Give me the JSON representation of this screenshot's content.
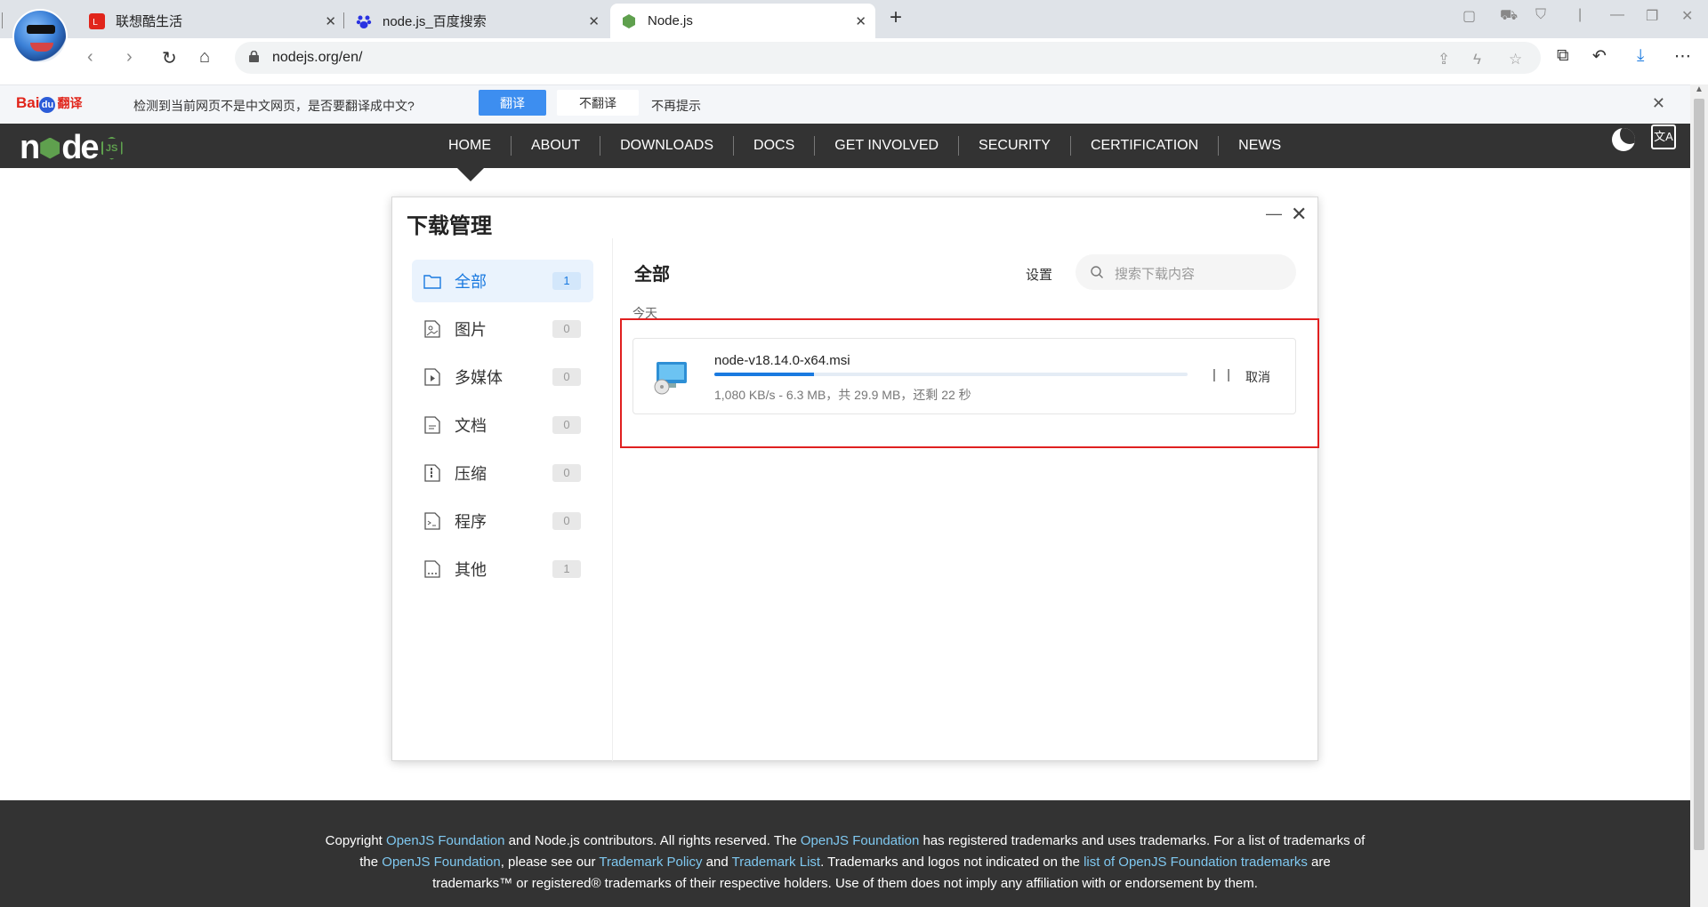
{
  "browser": {
    "tabs": [
      {
        "title": "联想酷生活",
        "icon": "lenovo-icon"
      },
      {
        "title": "node.js_百度搜索",
        "icon": "baidu-paw-icon"
      },
      {
        "title": "Node.js",
        "icon": "nodejs-hex-icon",
        "active": true
      }
    ],
    "new_tab_label": "+",
    "url": "nodejs.org/en/",
    "accent_color": "#1a7ae0"
  },
  "translate_bar": {
    "logo_text": "Bai",
    "logo_du": "du",
    "logo_suffix": "翻译",
    "message": "检测到当前网页不是中文网页，是否要翻译成中文?",
    "translate_label": "翻译",
    "no_translate_label": "不翻译",
    "never_label": "不再提示",
    "close_label": "✕"
  },
  "node_nav": {
    "logo_n": "n",
    "logo_de": "de",
    "logo_js": "JS",
    "links": [
      "HOME",
      "ABOUT",
      "DOWNLOADS",
      "DOCS",
      "GET INVOLVED",
      "SECURITY",
      "CERTIFICATION",
      "NEWS"
    ],
    "lang_label": "文A"
  },
  "download_manager": {
    "title": "下载管理",
    "minimize_label": "—",
    "close_label": "✕",
    "categories": [
      {
        "label": "全部",
        "count": "1",
        "icon": "folder-icon"
      },
      {
        "label": "图片",
        "count": "0",
        "icon": "image-file-icon"
      },
      {
        "label": "多媒体",
        "count": "0",
        "icon": "media-file-icon"
      },
      {
        "label": "文档",
        "count": "0",
        "icon": "document-file-icon"
      },
      {
        "label": "压缩",
        "count": "0",
        "icon": "archive-file-icon"
      },
      {
        "label": "程序",
        "count": "0",
        "icon": "program-file-icon"
      },
      {
        "label": "其他",
        "count": "1",
        "icon": "other-file-icon"
      }
    ],
    "heading": "全部",
    "settings_label": "设置",
    "search_placeholder": "搜索下载内容",
    "group_label": "今天",
    "item": {
      "filename": "node-v18.14.0-x64.msi",
      "progress": 0.21,
      "status": "1,080 KB/s - 6.3 MB，共 29.9 MB，还剩 22 秒",
      "pause_label": "| |",
      "cancel_label": "取消"
    }
  },
  "footer": {
    "t1": "Copyright ",
    "l1": "OpenJS Foundation",
    "t2": " and Node.js contributors. All rights reserved. The ",
    "l2": "OpenJS Foundation",
    "t3": " has registered trademarks and uses trademarks. For a list of trademarks of the ",
    "l3": "OpenJS Foundation",
    "t4": ", please see our ",
    "l4": "Trademark Policy",
    "t5": " and ",
    "l5": "Trademark List",
    "t6": ". Trademarks and logos not indicated on the ",
    "l6": "list of OpenJS Foundation trademarks",
    "t7": " are trademarks™ or registered® trademarks of their respective holders. Use of them does not imply any affiliation with or endorsement by them."
  }
}
